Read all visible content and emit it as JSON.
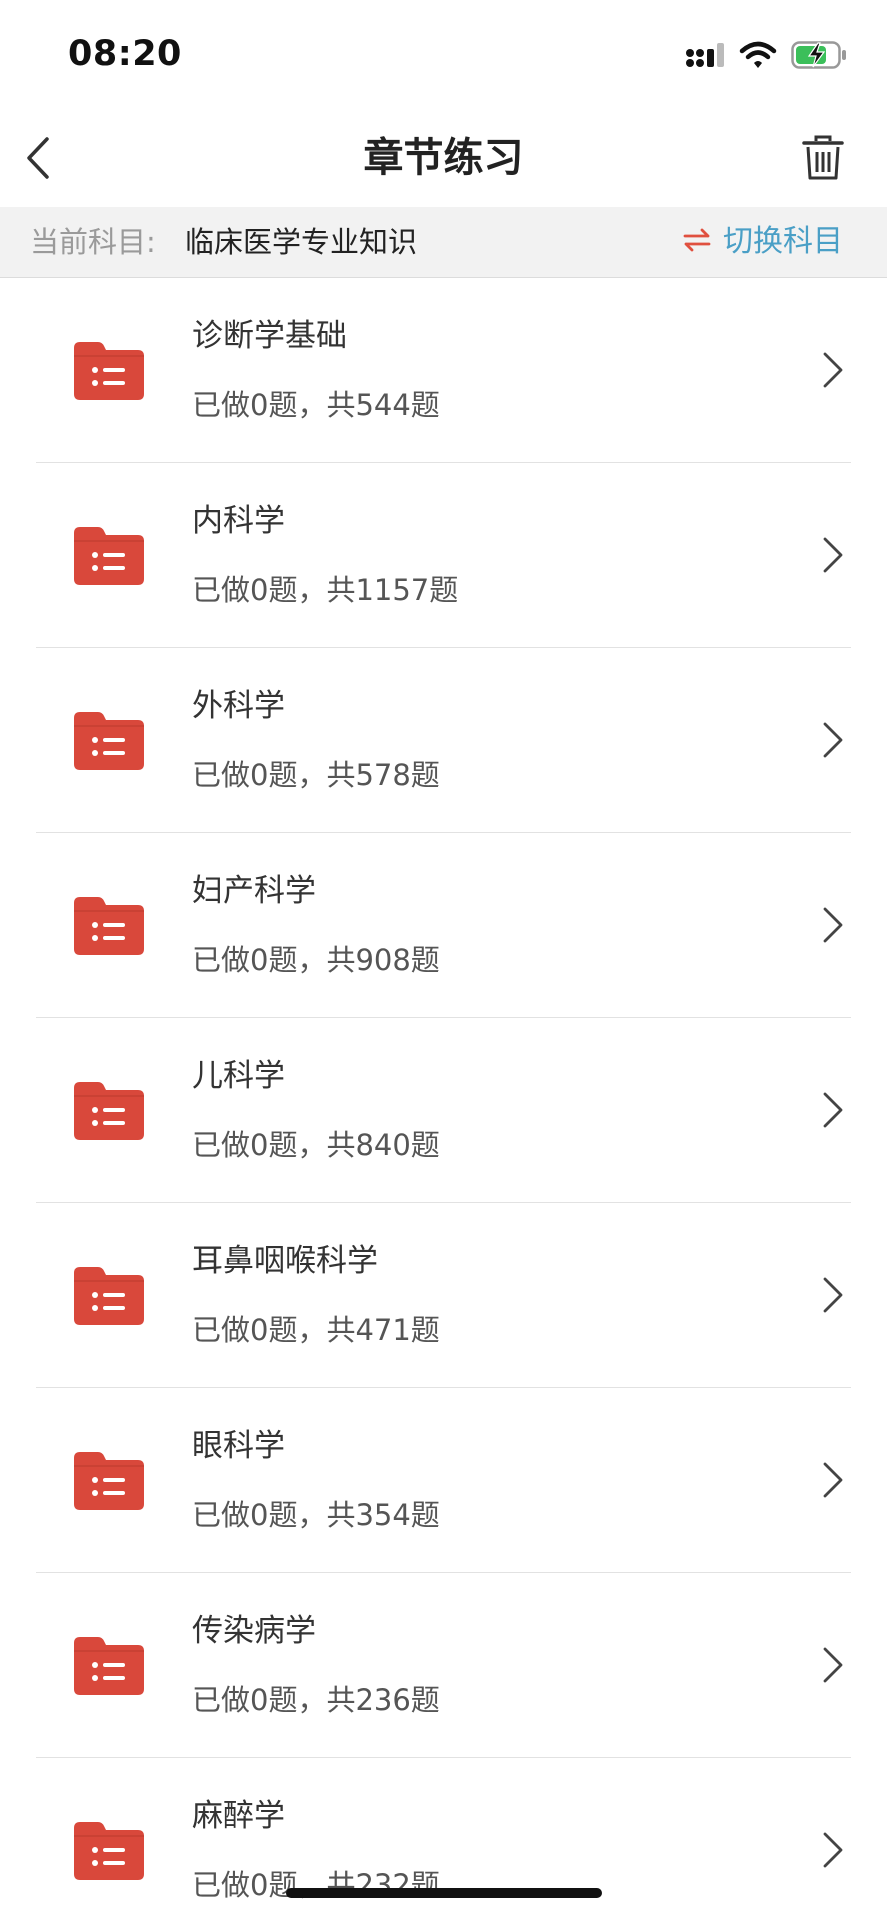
{
  "status_bar": {
    "time": "08:20",
    "signal_icon": "signal-icon",
    "wifi_icon": "wifi-icon",
    "battery_icon": "battery-charging-icon"
  },
  "nav": {
    "title": "章节练习",
    "back_icon": "chevron-left-icon",
    "trash_icon": "trash-icon"
  },
  "subject": {
    "label": "当前科目:",
    "value": "临床医学专业知识",
    "switch_label": "切换科目",
    "switch_icon": "swap-arrows-icon"
  },
  "chapters": [
    {
      "title": "诊断学基础",
      "progress": "已做0题，共544题"
    },
    {
      "title": "内科学",
      "progress": "已做0题，共1157题"
    },
    {
      "title": "外科学",
      "progress": "已做0题，共578题"
    },
    {
      "title": "妇产科学",
      "progress": "已做0题，共908题"
    },
    {
      "title": "儿科学",
      "progress": "已做0题，共840题"
    },
    {
      "title": "耳鼻咽喉科学",
      "progress": "已做0题，共471题"
    },
    {
      "title": "眼科学",
      "progress": "已做0题，共354题"
    },
    {
      "title": "传染病学",
      "progress": "已做0题，共236题"
    },
    {
      "title": "麻醉学",
      "progress": "已做0题，共232题"
    }
  ],
  "colors": {
    "folder_red": "#d9483b",
    "switch_blue": "#4a9fc6",
    "swap_icon_red": "#e0503f"
  }
}
